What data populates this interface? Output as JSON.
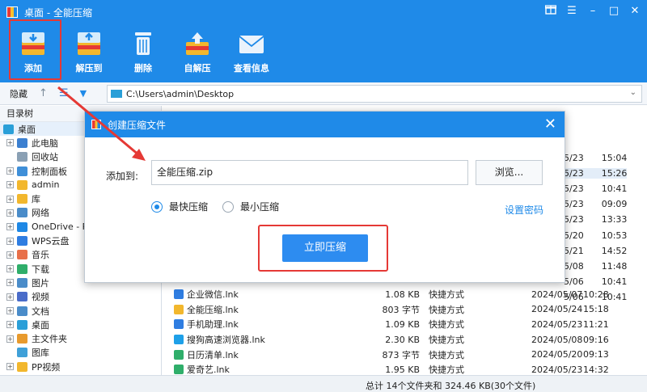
{
  "window": {
    "title": "桌面 - 全能压缩",
    "controls": [
      "gift-icon",
      "menu-icon",
      "minimize-icon",
      "maximize-icon",
      "close-icon"
    ]
  },
  "toolbar": {
    "items": [
      {
        "label": "添加",
        "icon": "add-archive-icon"
      },
      {
        "label": "解压到",
        "icon": "extract-icon"
      },
      {
        "label": "删除",
        "icon": "trash-icon"
      },
      {
        "label": "自解压",
        "icon": "self-extract-icon"
      },
      {
        "label": "查看信息",
        "icon": "mail-info-icon"
      }
    ]
  },
  "nav": {
    "hide_label": "隐藏",
    "path": "C:\\Users\\admin\\Desktop"
  },
  "tree": {
    "header": "目录树",
    "items": [
      {
        "label": "桌面",
        "expandable": false,
        "indent": 0,
        "color": "#2a9fd8"
      },
      {
        "label": "此电脑",
        "expandable": true,
        "indent": 1,
        "color": "#3b7fd0"
      },
      {
        "label": "回收站",
        "expandable": false,
        "indent": 1,
        "color": "#8aa0b4"
      },
      {
        "label": "控制面板",
        "expandable": true,
        "indent": 1,
        "color": "#3f8fd8"
      },
      {
        "label": "admin",
        "expandable": true,
        "indent": 1,
        "color": "#f2b72d"
      },
      {
        "label": "库",
        "expandable": true,
        "indent": 1,
        "color": "#f2b72d"
      },
      {
        "label": "网络",
        "expandable": true,
        "indent": 1,
        "color": "#4a8cc9"
      },
      {
        "label": "OneDrive - P",
        "expandable": true,
        "indent": 1,
        "color": "#1e88e5"
      },
      {
        "label": "WPS云盘",
        "expandable": true,
        "indent": 1,
        "color": "#2f7de1"
      },
      {
        "label": "音乐",
        "expandable": true,
        "indent": 1,
        "color": "#e8704a"
      },
      {
        "label": "下载",
        "expandable": true,
        "indent": 1,
        "color": "#2fae6a"
      },
      {
        "label": "图片",
        "expandable": true,
        "indent": 1,
        "color": "#4a8cc9"
      },
      {
        "label": "视频",
        "expandable": true,
        "indent": 1,
        "color": "#4a6cc9"
      },
      {
        "label": "文档",
        "expandable": true,
        "indent": 1,
        "color": "#4a8cc9"
      },
      {
        "label": "桌面",
        "expandable": true,
        "indent": 1,
        "color": "#2a9fd8"
      },
      {
        "label": "主文件夹",
        "expandable": true,
        "indent": 1,
        "color": "#e89a2d"
      },
      {
        "label": "图库",
        "expandable": false,
        "indent": 1,
        "color": "#3fa0d8"
      },
      {
        "label": "PP视频",
        "expandable": true,
        "indent": 1,
        "color": "#f2b72d"
      }
    ]
  },
  "partial_rows": [
    {
      "date": "5/23",
      "time": "15:04"
    },
    {
      "date": "5/23",
      "time": "15:26"
    },
    {
      "date": "5/23",
      "time": "10:41"
    },
    {
      "date": "5/23",
      "time": "09:09"
    },
    {
      "date": "5/23",
      "time": "13:33"
    },
    {
      "date": "5/20",
      "time": "10:53"
    },
    {
      "date": "5/21",
      "time": "14:52"
    },
    {
      "date": "5/08",
      "time": "11:48"
    },
    {
      "date": "5/06",
      "time": "10:41"
    },
    {
      "date": "5/06",
      "time": "10:41"
    }
  ],
  "files": [
    {
      "name": "企业微信.lnk",
      "size": "1.08 KB",
      "type": "快捷方式",
      "date": "2024/05/07",
      "time": "10:28",
      "color": "#2f7de1"
    },
    {
      "name": "全能压缩.lnk",
      "size": "803 字节",
      "type": "快捷方式",
      "date": "2024/05/24",
      "time": "15:18",
      "color": "#f2b72d"
    },
    {
      "name": "手机助理.lnk",
      "size": "1.09 KB",
      "type": "快捷方式",
      "date": "2024/05/23",
      "time": "11:21",
      "color": "#2f7de1"
    },
    {
      "name": "搜狗高速浏览器.lnk",
      "size": "2.30 KB",
      "type": "快捷方式",
      "date": "2024/05/08",
      "time": "09:16",
      "color": "#1ea0e8"
    },
    {
      "name": "日历清单.lnk",
      "size": "873 字节",
      "type": "快捷方式",
      "date": "2024/05/20",
      "time": "09:13",
      "color": "#2fae6a"
    },
    {
      "name": "爱奇艺.lnk",
      "size": "1.95 KB",
      "type": "快捷方式",
      "date": "2024/05/23",
      "time": "14:32",
      "color": "#2fae6a"
    }
  ],
  "status": "总计 14个文件夹和 324.46 KB(30个文件)",
  "dialog": {
    "title": "创建压缩文件",
    "add_to_label": "添加到:",
    "filename": "全能压缩.zip",
    "browse_label": "浏览...",
    "options": [
      {
        "label": "最快压缩",
        "selected": true
      },
      {
        "label": "最小压缩",
        "selected": false
      }
    ],
    "password_link": "设置密码",
    "start_label": "立即压缩"
  }
}
